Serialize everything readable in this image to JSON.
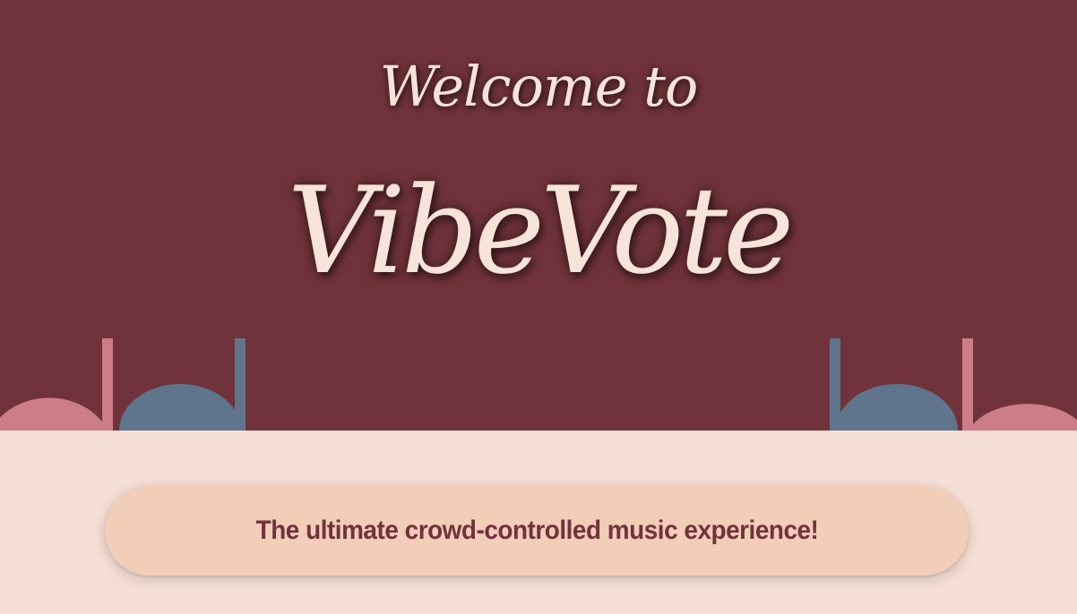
{
  "colors": {
    "hero_bg": "#71333b",
    "title_text": "#f6e3da",
    "note_pink": "#cc7d88",
    "note_blue": "#5f758c",
    "bottom_bg": "#f5ded4",
    "pill_bg": "#f2cdb8",
    "tagline_text": "#71333b"
  },
  "hero": {
    "welcome_text": "Welcome to",
    "brand_name": "VibeVote"
  },
  "decorations": {
    "left_notes_icon": "music-note-icon",
    "right_notes_icon": "music-note-icon"
  },
  "tagline": {
    "text": "The ultimate crowd-controlled music experience!"
  }
}
